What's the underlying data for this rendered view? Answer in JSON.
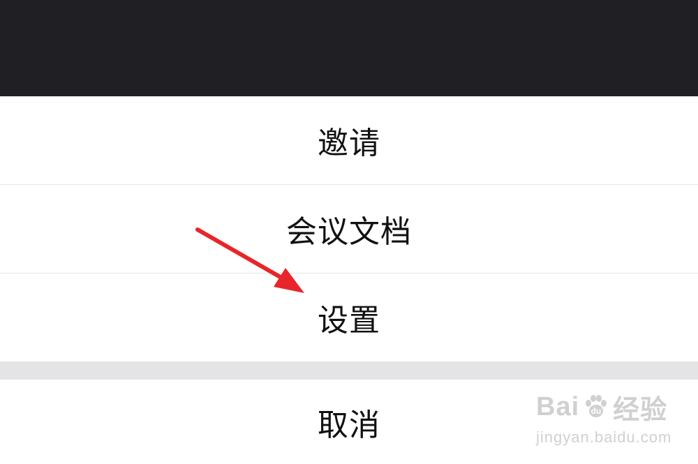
{
  "menu": {
    "items": [
      {
        "label": "邀请"
      },
      {
        "label": "会议文档"
      },
      {
        "label": "设置"
      }
    ],
    "cancel_label": "取消"
  },
  "watermark": {
    "brand_left": "Bai",
    "brand_mid": "du",
    "brand_right": "经验",
    "url": "jingyan.baidu.com"
  },
  "colors": {
    "backdrop": "#202024",
    "annotation_arrow": "#e8252a",
    "divider": "#e6e6e6",
    "gap": "#e4e4e6"
  }
}
